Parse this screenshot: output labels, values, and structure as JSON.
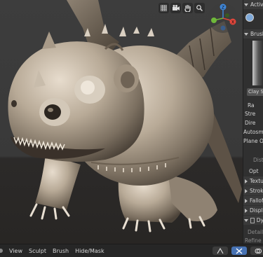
{
  "viewport": {
    "header_icons": [
      "grid-icon",
      "camera-icon",
      "hand-icon",
      "zoom-icon"
    ],
    "gizmo": {
      "x_label": "X",
      "y_label": "Y",
      "z_label": "Z",
      "x_color": "#e0463b",
      "y_color": "#6fb83a",
      "z_color": "#3f86d8"
    }
  },
  "side_panel": {
    "active_tool_header": "Active",
    "brush_header": "Brush",
    "brush_name": "Clay St",
    "props": [
      "Ra",
      "Stre",
      "Dire",
      "Autosm",
      "Plane O"
    ],
    "dist_label": "Dist",
    "options_label": "Opt",
    "sections": [
      "Textu",
      "Strok",
      "Fallof",
      "Displa",
      "Dy"
    ],
    "detail_label": "Detail",
    "refine_label": "Refine M"
  },
  "footer": {
    "menus": [
      "View",
      "Sculpt",
      "Brush",
      "Hide/Mask"
    ]
  },
  "colors": {
    "accent": "#4772b3",
    "background": "#2b2b2b",
    "panel": "#303030"
  }
}
